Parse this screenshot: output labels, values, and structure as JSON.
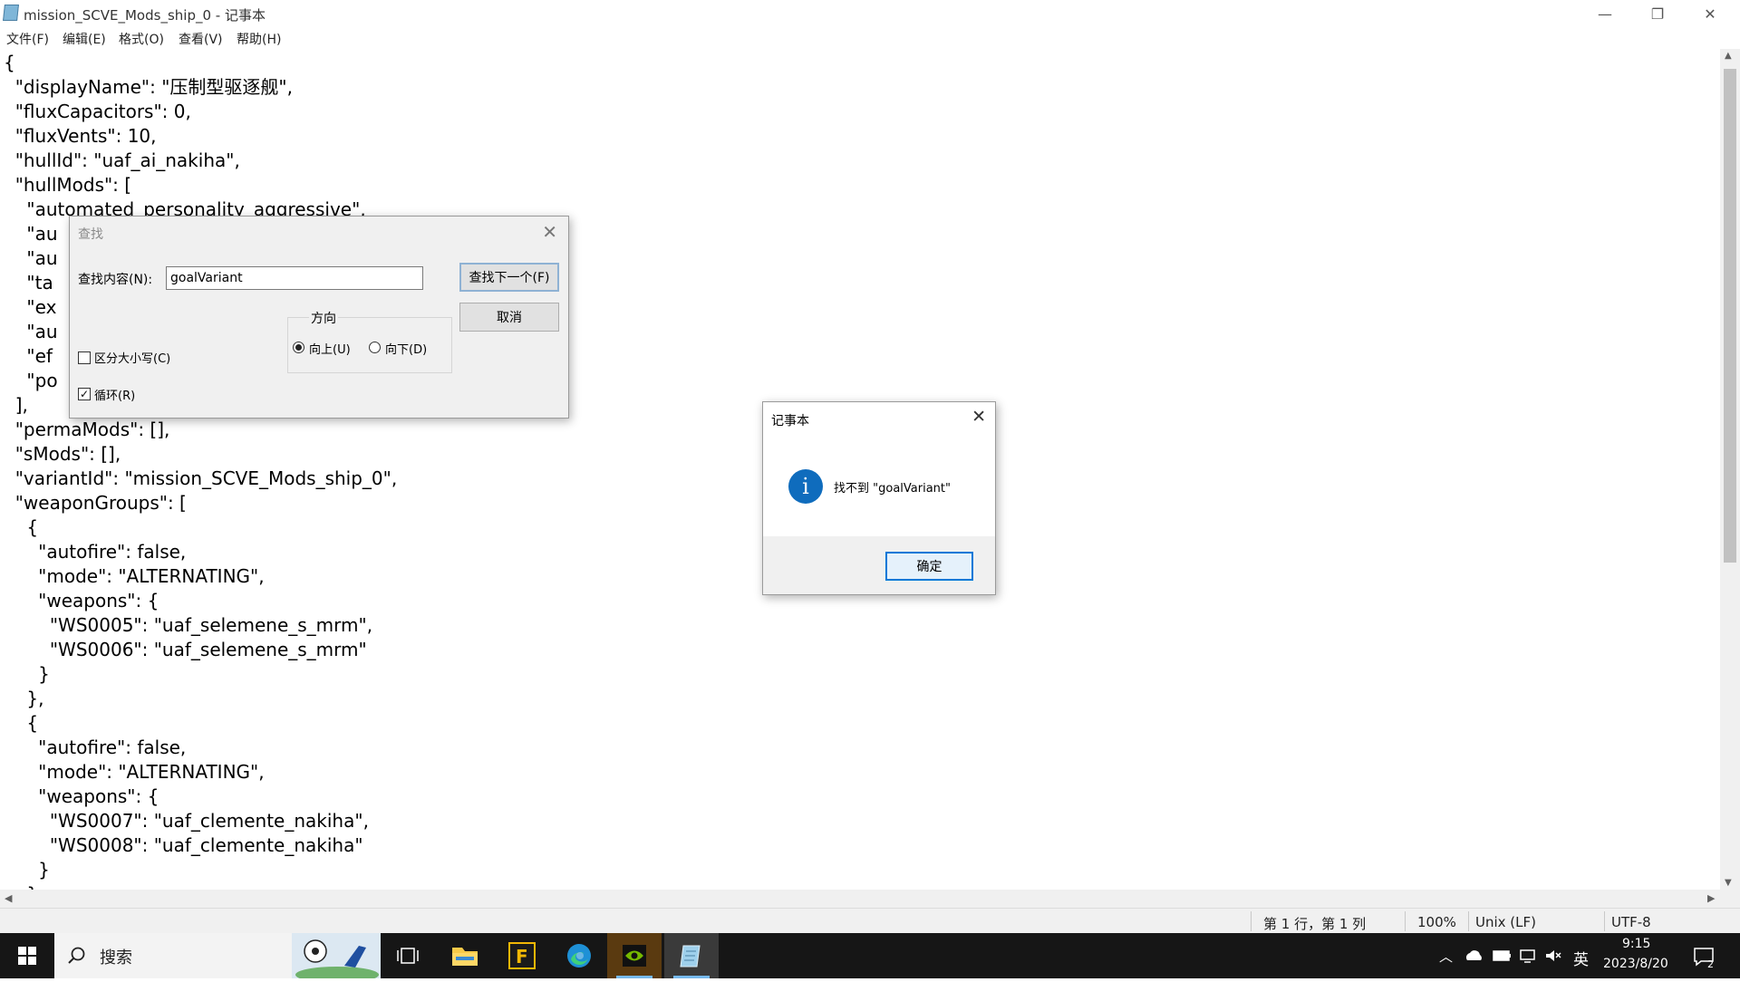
{
  "window": {
    "title": "mission_SCVE_Mods_ship_0 - 记事本",
    "minimize_glyph": "—",
    "maximize_glyph": "❐",
    "close_glyph": "✕"
  },
  "menu": [
    "文件(F)",
    "编辑(E)",
    "格式(O)",
    "查看(V)",
    "帮助(H)"
  ],
  "editor": {
    "text": "{\n  \"displayName\": \"压制型驱逐舰\",\n  \"fluxCapacitors\": 0,\n  \"fluxVents\": 10,\n  \"hullId\": \"uaf_ai_nakiha\",\n  \"hullMods\": [\n    \"automated_personality_aggressive\",\n    \"au\n    \"au\n    \"ta\n    \"ex\n    \"au\n    \"ef\n    \"po\n  ],\n  \"permaMods\": [],\n  \"sMods\": [],\n  \"variantId\": \"mission_SCVE_Mods_ship_0\",\n  \"weaponGroups\": [\n    {\n      \"autofire\": false,\n      \"mode\": \"ALTERNATING\",\n      \"weapons\": {\n        \"WS0005\": \"uaf_selemene_s_mrm\",\n        \"WS0006\": \"uaf_selemene_s_mrm\"\n      }\n    },\n    {\n      \"autofire\": false,\n      \"mode\": \"ALTERNATING\",\n      \"weapons\": {\n        \"WS0007\": \"uaf_clemente_nakiha\",\n        \"WS0008\": \"uaf_clemente_nakiha\"\n      }\n    }"
  },
  "find_dialog": {
    "title": "查找",
    "find_label": "查找内容(N):",
    "find_value": "goalVariant",
    "find_next": "查找下一个(F)",
    "cancel": "取消",
    "direction_label": "方向",
    "up": "向上(U)",
    "down": "向下(D)",
    "direction_selected": "up",
    "match_case": "区分大小写(C)",
    "match_case_checked": false,
    "wrap": "循环(R)",
    "wrap_checked": true
  },
  "message_dialog": {
    "title": "记事本",
    "message": "找不到 \"goalVariant\"",
    "ok": "确定",
    "icon": "info-icon",
    "icon_glyph": "i"
  },
  "status_bar": {
    "position": "第 1 行，第 1 列",
    "zoom": "100%",
    "line_ending": "Unix (LF)",
    "encoding": "UTF-8"
  },
  "taskbar": {
    "search_placeholder": "搜索",
    "time": "9:15",
    "date": "2023/8/20",
    "ime": "英",
    "notification_count": "2",
    "apps": [
      "task-view",
      "file-explorer",
      "f-app",
      "edge",
      "nvidia",
      "notepad"
    ]
  },
  "colors": {
    "accent": "#0078d7",
    "info_icon": "#0f6cbd",
    "taskbar": "#161616",
    "dialog_bg": "#f0f0f0"
  }
}
